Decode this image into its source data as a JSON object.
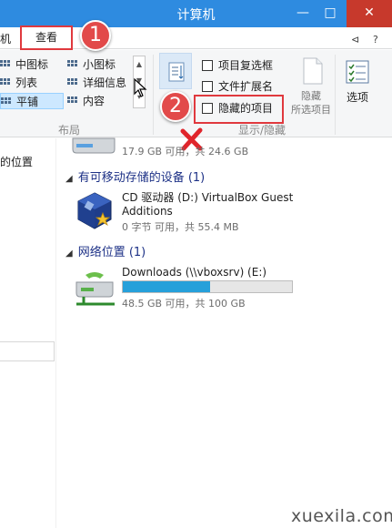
{
  "window": {
    "title": "计算机",
    "minimize_glyph": "—",
    "maximize_glyph": "□",
    "close_glyph": "✕"
  },
  "tabs": {
    "file_partial": "机",
    "view": "查看"
  },
  "ribbon": {
    "layout": {
      "items": [
        {
          "label": "中图标"
        },
        {
          "label": "小图标"
        },
        {
          "label": "列表"
        },
        {
          "label": "详细信息"
        },
        {
          "label": "平铺",
          "selected": true
        },
        {
          "label": "内容"
        }
      ],
      "group_label": "布局"
    },
    "show_hide": {
      "checkboxes": [
        {
          "label": "项目复选框",
          "checked": false
        },
        {
          "label": "文件扩展名",
          "checked": false
        },
        {
          "label": "隐藏的项目",
          "checked": false
        }
      ],
      "hide_selected_line1": "隐藏",
      "hide_selected_line2": "所选项目",
      "group_label": "显示/隐藏"
    },
    "options_label": "选项"
  },
  "annotations": {
    "badge1": "1",
    "badge2": "2",
    "cross_color": "#e0252b"
  },
  "content": {
    "left_pane_partial": "的位置",
    "first_drive_stat": "17.9 GB 可用，共 24.6 GB",
    "removable_section": "有可移动存储的设备 (1)",
    "cd_drive": {
      "name": "CD 驱动器 (D:) VirtualBox Guest Additions",
      "stat": "0 字节 可用，共 55.4 MB"
    },
    "network_section": "网络位置 (1)",
    "net_drive": {
      "name": "Downloads (\\\\vboxsrv) (E:)",
      "stat": "48.5 GB 可用，共 100 GB",
      "used_fraction": 0.515
    }
  },
  "watermark": "xuexila.com",
  "colors": {
    "titlebar": "#2e8be0",
    "close_button": "#c7392c",
    "highlight": "#e0393e",
    "progress_fill": "#26a0da",
    "section_title": "#1e3287"
  }
}
